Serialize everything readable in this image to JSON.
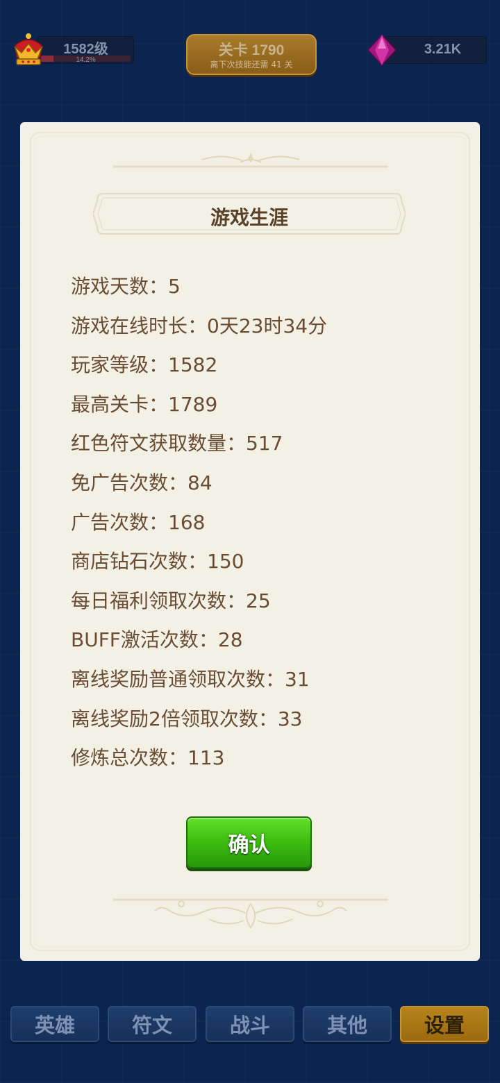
{
  "header": {
    "player_level_label": "1582级",
    "level_progress_label": "14.2%",
    "level_progress_fraction": 0.142,
    "stage_title": "关卡 1790",
    "stage_subtitle": "离下次技能还需 41 关",
    "gems_value": "3.21K"
  },
  "dialog": {
    "title": "游戏生涯",
    "stats": [
      "游戏天数：5",
      "游戏在线时长：0天23时34分",
      "玩家等级：1582",
      "最高关卡：1789",
      "红色符文获取数量：517",
      "免广告次数：84",
      "广告次数：168",
      "商店钻石次数：150",
      "每日福利领取次数：25",
      "BUFF激活次数：28",
      "离线奖励普通领取次数：31",
      "离线奖励2倍领取次数：33",
      "修炼总次数：113"
    ],
    "confirm_label": "确认"
  },
  "nav": {
    "items": [
      {
        "label": "英雄",
        "active": false
      },
      {
        "label": "符文",
        "active": false
      },
      {
        "label": "战斗",
        "active": false
      },
      {
        "label": "其他",
        "active": false
      },
      {
        "label": "设置",
        "active": true
      }
    ]
  },
  "colors": {
    "background": "#0c2450",
    "dialog_bg": "#f3f1e6",
    "stat_text": "#6a4c33",
    "confirm_green": "#3fbf12",
    "active_tab": "#b78319"
  },
  "icons": {
    "level": "crown-icon",
    "currency": "gem-icon"
  }
}
